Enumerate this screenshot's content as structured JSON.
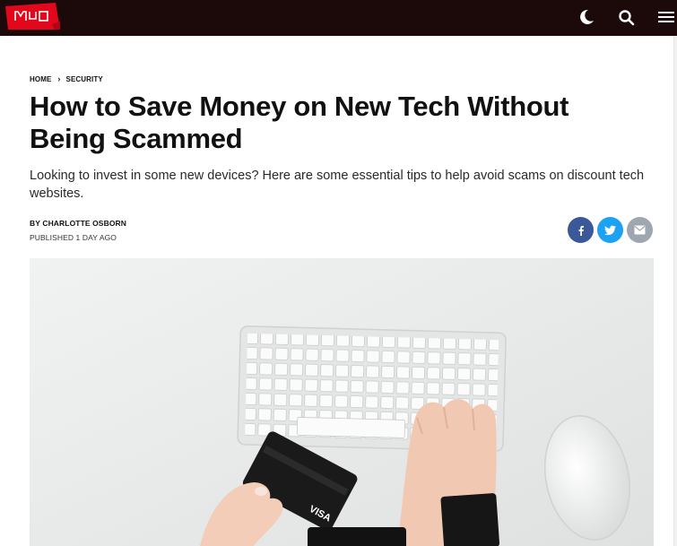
{
  "site": {
    "logo_text": "MUO",
    "brand_color": "#e2071a",
    "header_bg": "#1c0a0a"
  },
  "header": {
    "icons": [
      "moon-icon",
      "search-icon",
      "hamburger-menu-icon"
    ]
  },
  "breadcrumb": {
    "items": [
      "HOME",
      "SECURITY"
    ],
    "separator_icon": "chevron-right-icon"
  },
  "article": {
    "title": "How to Save Money on New Tech Without Being Scammed",
    "subtitle": "Looking to invest in some new devices? Here are some essential tips to help avoid scams on discount tech websites.",
    "byline_prefix": "BY ",
    "author": "CHARLOTTE OSBORN",
    "published": "PUBLISHED 1 DAY AGO"
  },
  "share": {
    "buttons": [
      {
        "icon": "facebook-icon",
        "color": "#3b5998"
      },
      {
        "icon": "twitter-icon",
        "color": "#1da1f2"
      },
      {
        "icon": "email-icon",
        "color": "#9ea6b0"
      }
    ]
  },
  "hero_image": {
    "card_text": "VISA"
  }
}
